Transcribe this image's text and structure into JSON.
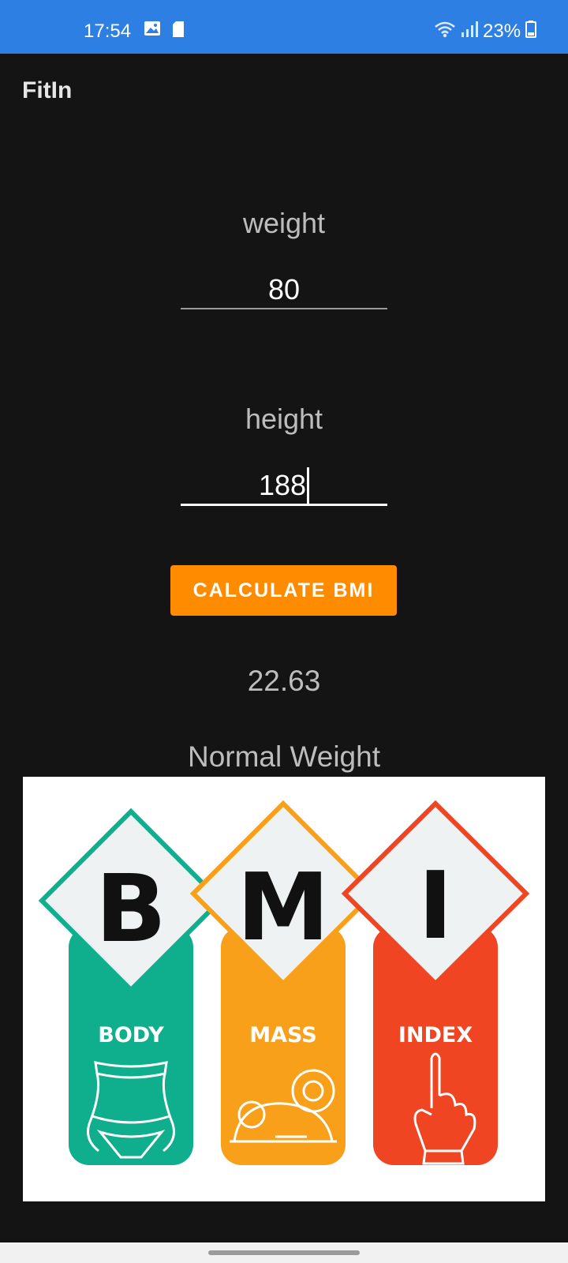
{
  "status_bar": {
    "time": "17:54",
    "battery": "23%",
    "icons": [
      "image-icon",
      "sd-card-icon",
      "wifi-icon",
      "signal-icon",
      "battery-icon"
    ],
    "background_color": "#2e7fe3"
  },
  "app_bar": {
    "title": "FitIn"
  },
  "form": {
    "weight": {
      "label": "weight",
      "value": "80"
    },
    "height": {
      "label": "height",
      "value": "188"
    }
  },
  "calculate_button": {
    "label": "CALCULATE BMI",
    "color": "#ff8c00"
  },
  "result": {
    "bmi_value": "22.63",
    "category": "Normal Weight"
  },
  "bmi_image": {
    "letters": [
      "B",
      "M",
      "I"
    ],
    "words": [
      "BODY",
      "MASS",
      "INDEX"
    ],
    "colors": [
      "#0fae8c",
      "#f9a01b",
      "#f04523"
    ]
  }
}
